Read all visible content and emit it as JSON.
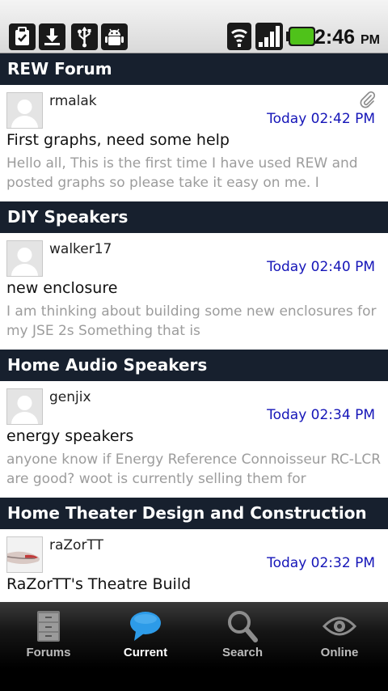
{
  "status_bar": {
    "time": "2:46",
    "ampm": "PM",
    "left_icons": [
      "clipboard-icon",
      "download-icon",
      "usb-icon",
      "android-debug-icon"
    ],
    "right_icons": [
      "wifi-icon",
      "signal-icon",
      "battery-icon"
    ],
    "battery_color": "#4fc21a"
  },
  "sections": [
    {
      "header": "REW Forum",
      "post": {
        "author": "rmalak",
        "time": "Today 02:42 PM",
        "title": "First graphs, need some help",
        "snippet": "Hello all,  This is the first time I have used REW and posted graphs so please take it easy on me. I",
        "has_attachment": true
      }
    },
    {
      "header": "DIY Speakers",
      "post": {
        "author": "walker17",
        "time": "Today 02:40 PM",
        "title": "new enclosure",
        "snippet": "I am thinking about building some new enclosures for my JSE 2s Something that is",
        "has_attachment": false
      }
    },
    {
      "header": "Home Audio Speakers",
      "post": {
        "author": "genjix",
        "time": "Today 02:34 PM",
        "title": "energy speakers",
        "snippet": "anyone know if Energy Reference Connoisseur RC-LCR  are good? woot is currently selling them for",
        "has_attachment": false
      }
    },
    {
      "header": "Home Theater Design and Construction",
      "post": {
        "author": "raZorTT",
        "time": "Today 02:32 PM",
        "title": "RaZorTT's Theatre Build",
        "snippet": "",
        "has_attachment": false
      }
    }
  ],
  "tabs": [
    {
      "label": "Forums",
      "icon": "cabinet-icon",
      "active": false
    },
    {
      "label": "Current",
      "icon": "speech-bubble-icon",
      "active": true
    },
    {
      "label": "Search",
      "icon": "magnifier-icon",
      "active": false
    },
    {
      "label": "Online",
      "icon": "eye-icon",
      "active": false
    }
  ],
  "colors": {
    "section_header_bg": "#17202e",
    "time_text": "#1515b8",
    "active_tab_icon": "#2d9be8"
  }
}
